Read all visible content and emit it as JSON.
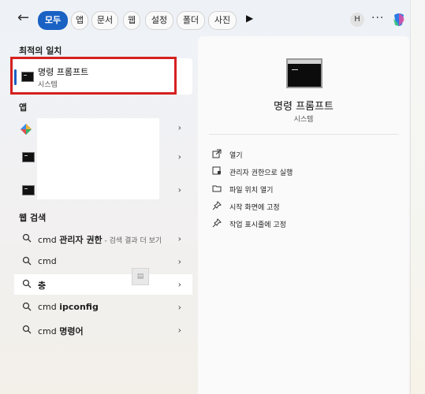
{
  "topbar": {
    "chips": [
      "모두",
      "앱",
      "문서",
      "웹",
      "설정",
      "폴더",
      "사진"
    ],
    "avatar": "H",
    "more": "···"
  },
  "left": {
    "best_match_title": "최적의 일치",
    "best_match": {
      "title": "명령 프롬프트",
      "subtitle": "시스템"
    },
    "apps_title": "앱",
    "web_title": "웹 검색",
    "web_results": [
      {
        "prefix": "cmd ",
        "bold": "관리자 권한",
        "suffix": " - 검색 결과 더 보기"
      },
      {
        "prefix": "cmd",
        "bold": "",
        "suffix": ""
      },
      {
        "prefix": "",
        "bold": "충",
        "suffix": ""
      },
      {
        "prefix": "cmd ",
        "bold": "ipconfig",
        "suffix": ""
      },
      {
        "prefix": "cmd ",
        "bold": "명령어",
        "suffix": ""
      }
    ]
  },
  "right": {
    "title": "명령 프롬프트",
    "subtitle": "시스템",
    "actions": [
      "열기",
      "관리자 권한으로 실행",
      "파일 위치 열기",
      "시작 화면에 고정",
      "작업 표시줄에 고정"
    ]
  },
  "icons": [
    "back-arrow-icon",
    "play-icon",
    "copilot-icon",
    "cmd-icon",
    "gem-icon",
    "search-icon",
    "chevron-right-icon",
    "open-icon",
    "shield-icon",
    "folder-icon",
    "pin-icon"
  ],
  "colors": {
    "accent": "#1a61c4",
    "highlight": "#d62020"
  }
}
